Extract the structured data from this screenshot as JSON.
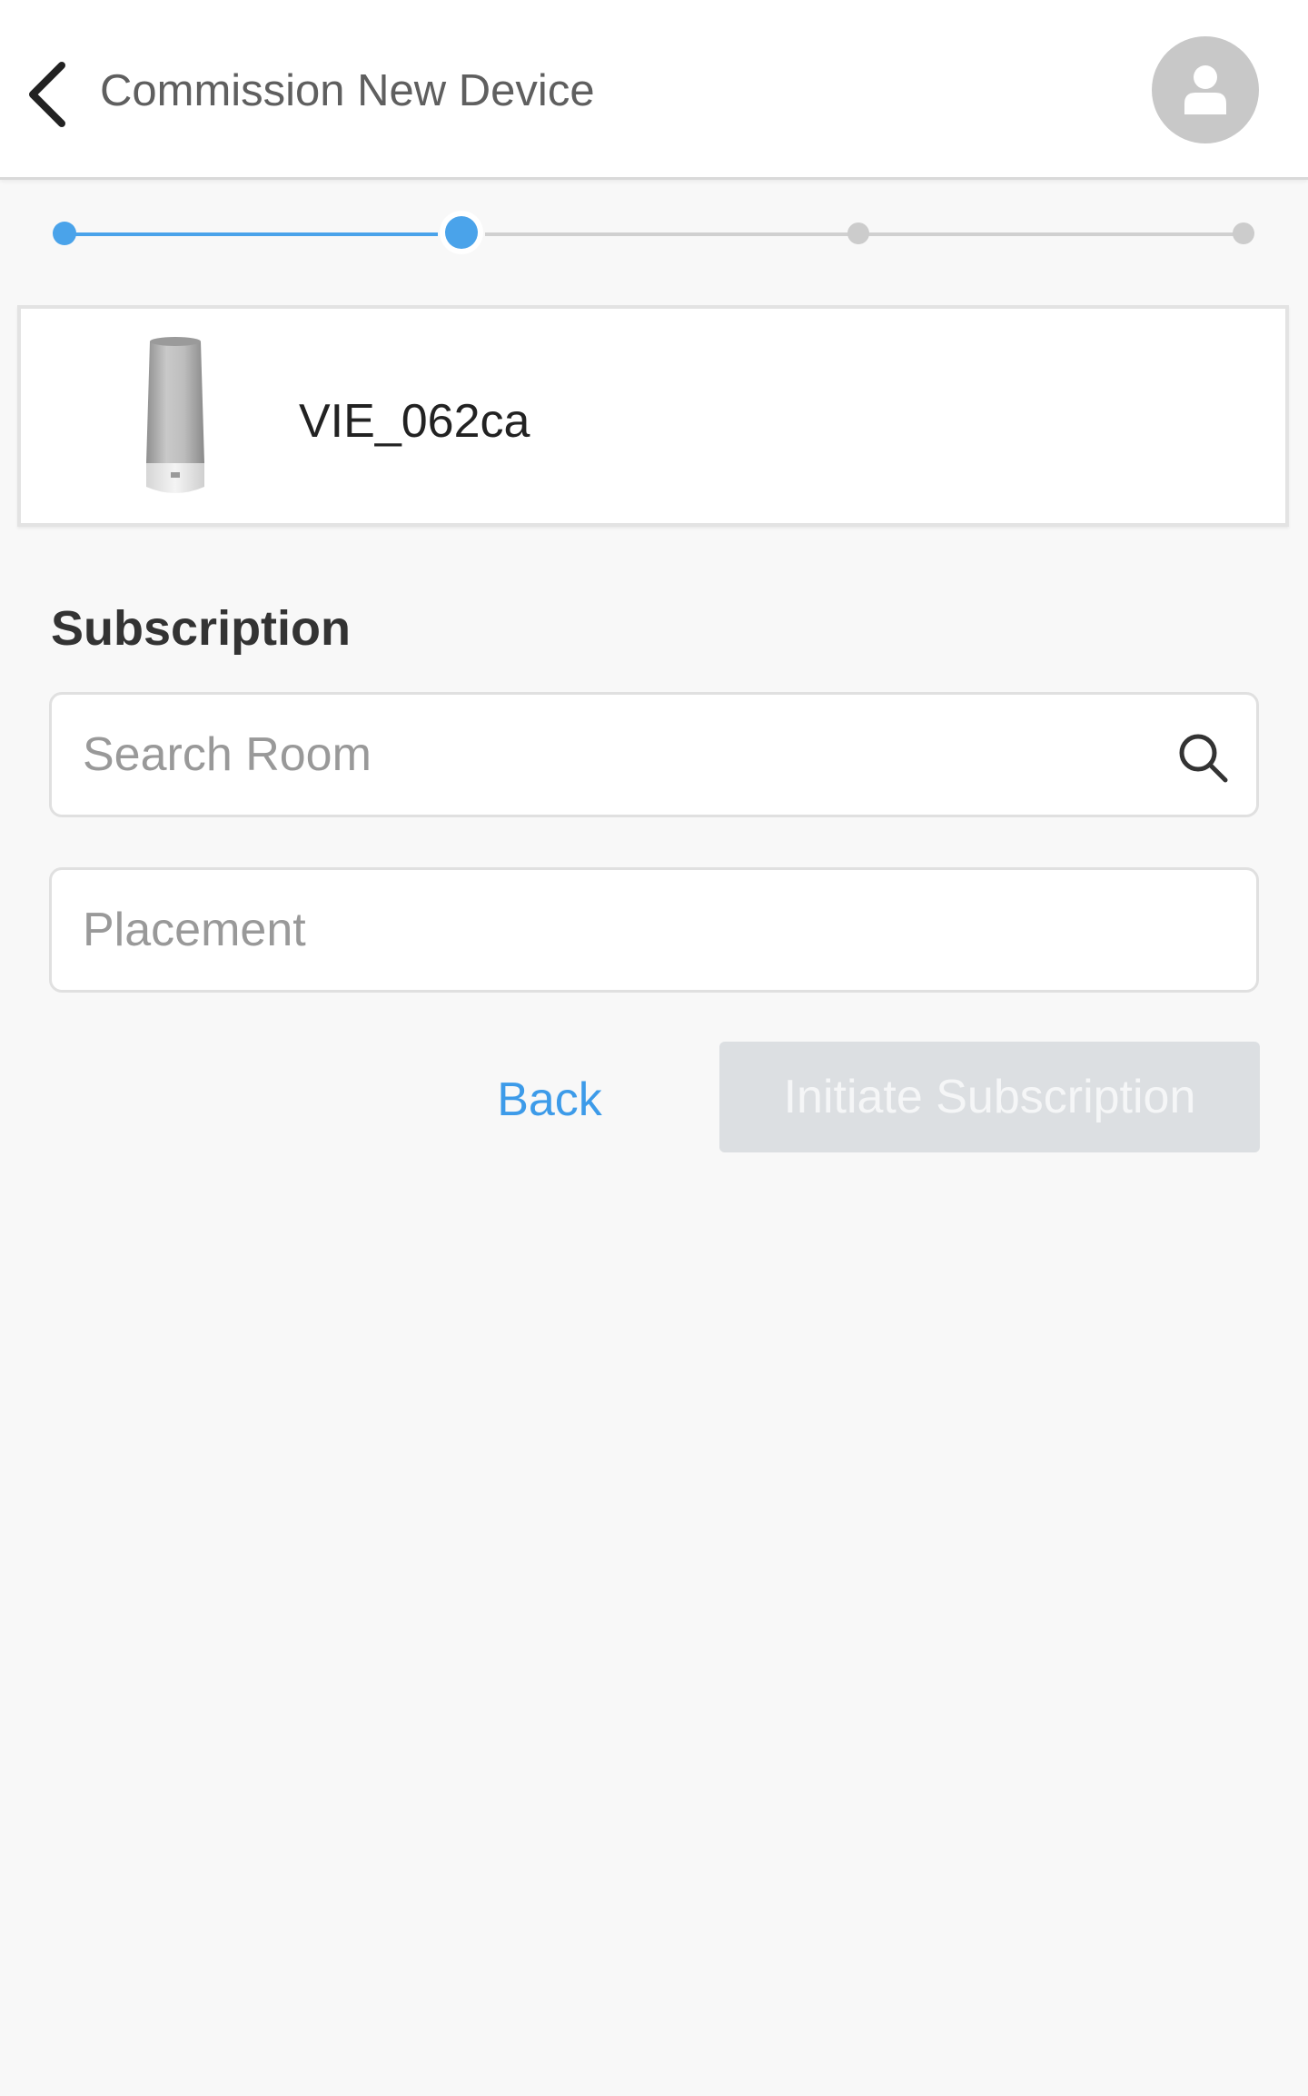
{
  "header": {
    "title": "Commission New Device",
    "back_icon": "chevron-left-icon",
    "avatar_icon": "user-icon"
  },
  "stepper": {
    "total_steps": 4,
    "current_step": 2,
    "active_color": "#4aa3ea",
    "inactive_color": "#cccccc"
  },
  "device": {
    "name": "VIE_062ca",
    "image_icon": "smart-speaker-image"
  },
  "subscription": {
    "title": "Subscription",
    "search_room": {
      "value": "",
      "placeholder": "Search Room",
      "icon": "search-icon"
    },
    "placement": {
      "value": "",
      "placeholder": "Placement"
    }
  },
  "actions": {
    "back_label": "Back",
    "initiate_label": "Initiate Subscription",
    "initiate_enabled": false,
    "link_color": "#3d9be9"
  }
}
